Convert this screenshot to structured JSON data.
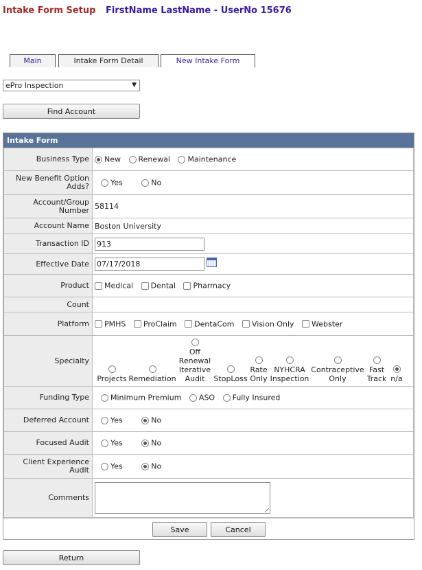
{
  "header": {
    "title": "Intake Form Setup",
    "user": "FirstName LastName - UserNo 15676"
  },
  "tabs": [
    {
      "label": "Main"
    },
    {
      "label": "Intake Form Detail"
    },
    {
      "label": "New Intake Form"
    }
  ],
  "selected_form": "ePro Inspection",
  "find_account_label": "Find Account",
  "form": {
    "title": "Intake Form",
    "business_type": {
      "label": "Business Type",
      "options": [
        "New",
        "Renewal",
        "Maintenance"
      ]
    },
    "benefit": {
      "label": "New Benefit Option Adds?",
      "options": [
        "Yes",
        "No"
      ]
    },
    "account_number": {
      "label": "Account/Group Number",
      "value": "58114"
    },
    "account_name": {
      "label": "Account Name",
      "value": "Boston University"
    },
    "transaction_id": {
      "label": "Transaction ID",
      "value": "913"
    },
    "effective_date": {
      "label": "Effective Date",
      "value": "07/17/2018"
    },
    "product": {
      "label": "Product",
      "options": [
        "Medical",
        "Dental",
        "Pharmacy"
      ]
    },
    "count": {
      "label": "Count"
    },
    "platform": {
      "label": "Platform",
      "options": [
        "PMHS",
        "ProClaim",
        "DentaCom",
        "Vision Only",
        "Webster"
      ]
    },
    "specialty": {
      "label": "Specialty",
      "options": [
        "Projects",
        "Remediation",
        "Off Renewal Iterative Audit",
        "StopLoss",
        "Rate Only",
        "NYHCRA Inspection",
        "Contraceptive Only",
        "Fast Track",
        "n/a"
      ]
    },
    "funding": {
      "label": "Funding Type",
      "options": [
        "Minimum Premium",
        "ASO",
        "Fully Insured"
      ]
    },
    "deferred": {
      "label": "Deferred Account",
      "options": [
        "Yes",
        "No"
      ]
    },
    "focused": {
      "label": "Focused Audit",
      "options": [
        "Yes",
        "No"
      ]
    },
    "client_exp": {
      "label": "Client Experience Audit",
      "options": [
        "Yes",
        "No"
      ]
    },
    "comments": {
      "label": "Comments"
    },
    "save_label": "Save",
    "cancel_label": "Cancel"
  },
  "return_label": "Return"
}
